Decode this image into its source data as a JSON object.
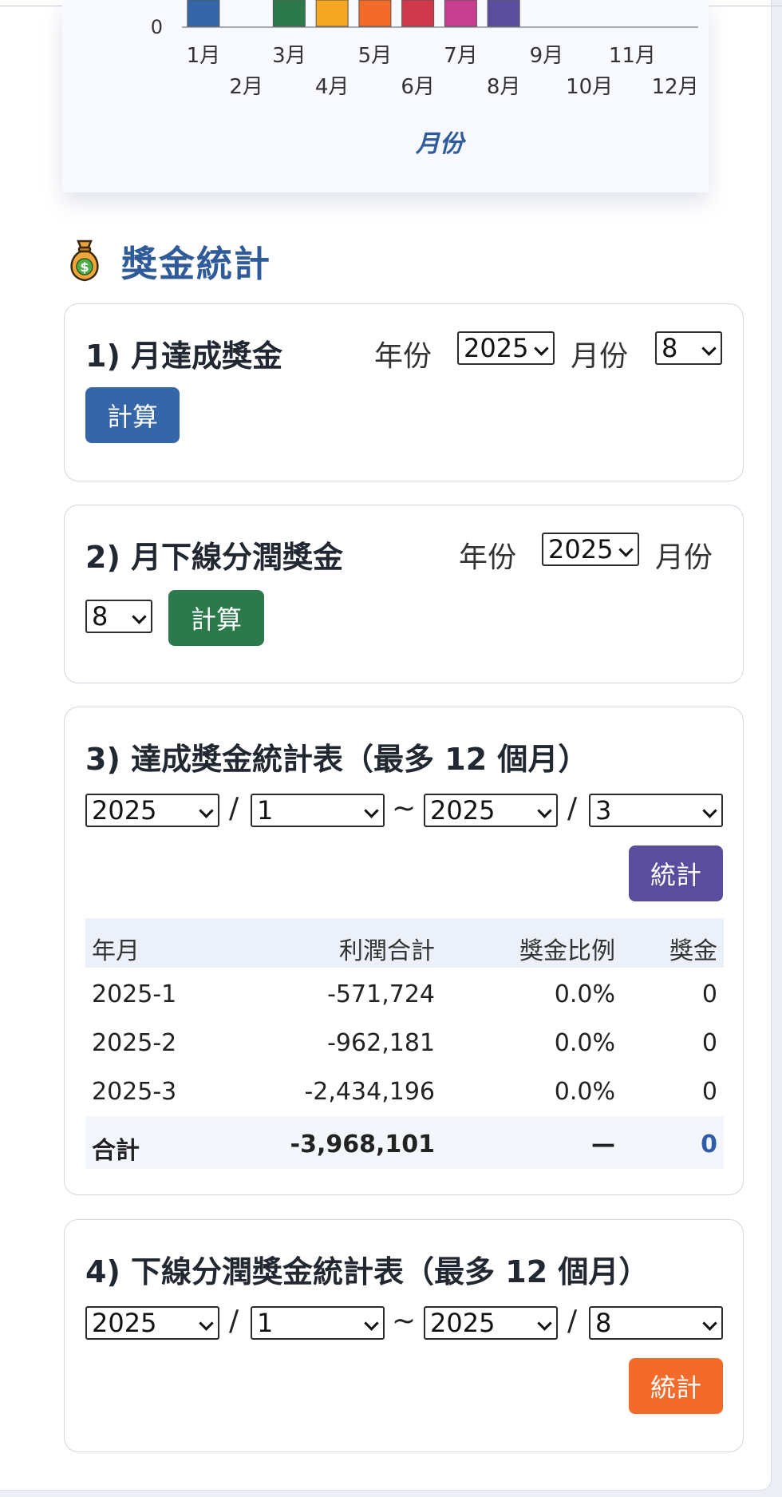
{
  "chart_data": {
    "type": "bar",
    "categories": [
      "1月",
      "2月",
      "3月",
      "4月",
      "5月",
      "6月",
      "7月",
      "8月",
      "9月",
      "10月",
      "11月",
      "12月"
    ],
    "xlabel": "月份",
    "ytick_visible": "0",
    "bar_colors": [
      "#3566a8",
      "#3566a8",
      "#2c7a4b",
      "#f5a623",
      "#f26b2a",
      "#d0384b",
      "#c93f8f",
      "#5b4d9e",
      "#8a8f9c",
      "#8a8f9c",
      "#8a8f9c",
      "#8a8f9c"
    ],
    "values": [
      1,
      0,
      1,
      1,
      1,
      1,
      1,
      1,
      0,
      0,
      0,
      0
    ]
  },
  "section": {
    "title": "獎金統計",
    "icon": "money-bag-icon"
  },
  "card1": {
    "heading": "1) 月達成獎金",
    "year_label": "年份",
    "year_value": "2025",
    "month_label": "月份",
    "month_value": "8",
    "button": "計算",
    "button_color": "#3566a8"
  },
  "card2": {
    "heading": "2) 月下線分潤獎金",
    "year_label": "年份",
    "year_value": "2025",
    "month_label": "月份",
    "month_value": "8",
    "button": "計算",
    "button_color": "#2c7a4b"
  },
  "card3": {
    "heading": "3) 達成獎金統計表（最多 12 個月）",
    "from_year": "2025",
    "from_month": "1",
    "to_year": "2025",
    "to_month": "3",
    "slash": "/",
    "tilde": "~",
    "button": "統計",
    "button_color": "#5b4d9e",
    "table": {
      "headers": [
        "年月",
        "利潤合計",
        "獎金比例",
        "獎金"
      ],
      "rows": [
        [
          "2025-1",
          "-571,724",
          "0.0%",
          "0"
        ],
        [
          "2025-2",
          "-962,181",
          "0.0%",
          "0"
        ],
        [
          "2025-3",
          "-2,434,196",
          "0.0%",
          "0"
        ]
      ],
      "total": [
        "合計",
        "-3,968,101",
        "—",
        "0"
      ]
    }
  },
  "card4": {
    "heading": "4) 下線分潤獎金統計表（最多 12 個月）",
    "from_year": "2025",
    "from_month": "1",
    "to_year": "2025",
    "to_month": "8",
    "slash": "/",
    "tilde": "~",
    "button": "統計",
    "button_color": "#f26b2a"
  }
}
